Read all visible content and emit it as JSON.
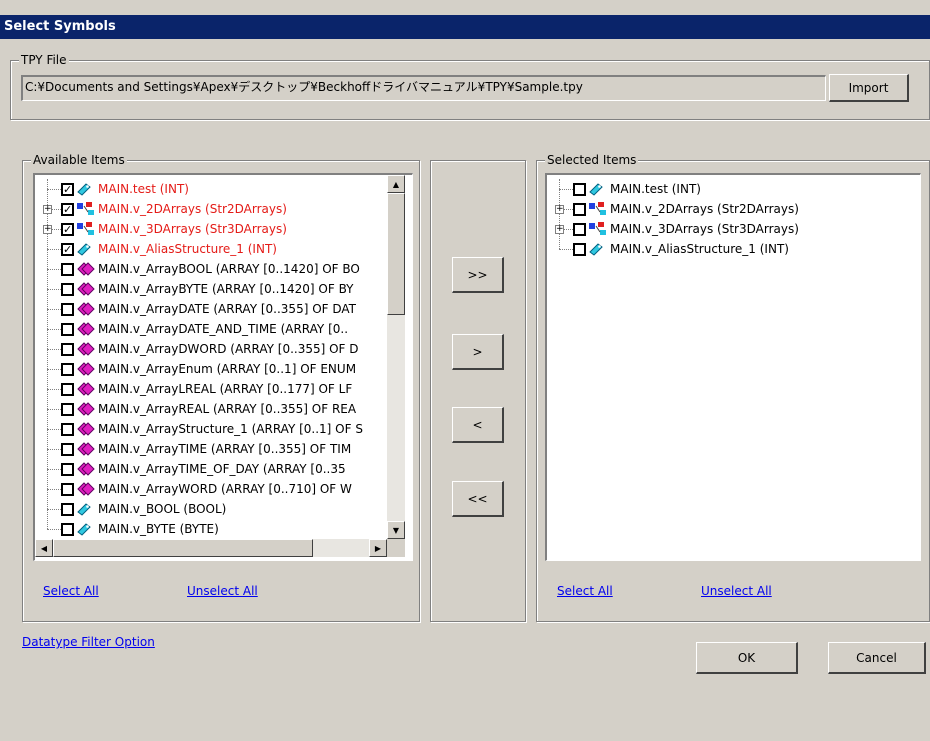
{
  "window": {
    "title": "Select Symbols"
  },
  "tpy_file": {
    "legend": "TPY File",
    "path": "C:¥Documents and Settings¥Apex¥デスクトップ¥Beckhoffドライバマニュアル¥TPY¥Sample.tpy",
    "import_label": "Import"
  },
  "available": {
    "legend": "Available Items",
    "select_all": "Select All",
    "unselect_all": "Unselect All",
    "items": [
      {
        "label": "MAIN.test  (INT)",
        "checked": true,
        "red": true,
        "icon": "tag-icon",
        "expandable": false
      },
      {
        "label": "MAIN.v_2DArrays  (Str2DArrays)",
        "checked": true,
        "red": true,
        "icon": "structure-icon",
        "expandable": true
      },
      {
        "label": "MAIN.v_3DArrays  (Str3DArrays)",
        "checked": true,
        "red": true,
        "icon": "structure-icon",
        "expandable": true
      },
      {
        "label": "MAIN.v_AliasStructure_1  (INT)",
        "checked": true,
        "red": true,
        "icon": "tag-icon",
        "expandable": false
      },
      {
        "label": "MAIN.v_ArrayBOOL  (ARRAY [0..1420] OF BO",
        "checked": false,
        "red": false,
        "icon": "array-icon",
        "expandable": false
      },
      {
        "label": "MAIN.v_ArrayBYTE  (ARRAY [0..1420] OF BY",
        "checked": false,
        "red": false,
        "icon": "array-icon",
        "expandable": false
      },
      {
        "label": "MAIN.v_ArrayDATE  (ARRAY [0..355] OF DAT",
        "checked": false,
        "red": false,
        "icon": "array-icon",
        "expandable": false
      },
      {
        "label": "MAIN.v_ArrayDATE_AND_TIME  (ARRAY [0..",
        "checked": false,
        "red": false,
        "icon": "array-icon",
        "expandable": false
      },
      {
        "label": "MAIN.v_ArrayDWORD  (ARRAY [0..355] OF D",
        "checked": false,
        "red": false,
        "icon": "array-icon",
        "expandable": false
      },
      {
        "label": "MAIN.v_ArrayEnum  (ARRAY [0..1] OF ENUM",
        "checked": false,
        "red": false,
        "icon": "array-icon",
        "expandable": false
      },
      {
        "label": "MAIN.v_ArrayLREAL  (ARRAY [0..177] OF LF",
        "checked": false,
        "red": false,
        "icon": "array-icon",
        "expandable": false
      },
      {
        "label": "MAIN.v_ArrayREAL  (ARRAY [0..355] OF REA",
        "checked": false,
        "red": false,
        "icon": "array-icon",
        "expandable": false
      },
      {
        "label": "MAIN.v_ArrayStructure_1  (ARRAY [0..1] OF S",
        "checked": false,
        "red": false,
        "icon": "array-icon",
        "expandable": false
      },
      {
        "label": "MAIN.v_ArrayTIME  (ARRAY [0..355] OF TIM",
        "checked": false,
        "red": false,
        "icon": "array-icon",
        "expandable": false
      },
      {
        "label": "MAIN.v_ArrayTIME_OF_DAY  (ARRAY [0..35",
        "checked": false,
        "red": false,
        "icon": "array-icon",
        "expandable": false
      },
      {
        "label": "MAIN.v_ArrayWORD  (ARRAY [0..710] OF W",
        "checked": false,
        "red": false,
        "icon": "array-icon",
        "expandable": false
      },
      {
        "label": "MAIN.v_BOOL  (BOOL)",
        "checked": false,
        "red": false,
        "icon": "tag-icon",
        "expandable": false
      },
      {
        "label": "MAIN.v_BYTE  (BYTE)",
        "checked": false,
        "red": false,
        "icon": "tag-icon",
        "expandable": false
      }
    ]
  },
  "transfer": {
    "add_all": ">>",
    "add": ">",
    "remove": "<",
    "remove_all": "<<"
  },
  "selected": {
    "legend": "Selected Items",
    "select_all": "Select All",
    "unselect_all": "Unselect All",
    "items": [
      {
        "label": "MAIN.test  (INT)",
        "checked": false,
        "red": false,
        "icon": "tag-icon",
        "expandable": false
      },
      {
        "label": "MAIN.v_2DArrays  (Str2DArrays)",
        "checked": false,
        "red": false,
        "icon": "structure-icon",
        "expandable": true
      },
      {
        "label": "MAIN.v_3DArrays  (Str3DArrays)",
        "checked": false,
        "red": false,
        "icon": "structure-icon",
        "expandable": true
      },
      {
        "label": "MAIN.v_AliasStructure_1  (INT)",
        "checked": false,
        "red": false,
        "icon": "tag-icon",
        "expandable": false
      }
    ]
  },
  "footer": {
    "filter_link": "Datatype Filter Option",
    "ok_label": "OK",
    "cancel_label": "Cancel"
  },
  "colors": {
    "title_bar": "#0a246a",
    "selected_text": "#e41b17",
    "link": "#0000ee",
    "array_icon": "#e020c0",
    "tag_icon": "#30c8e0"
  }
}
